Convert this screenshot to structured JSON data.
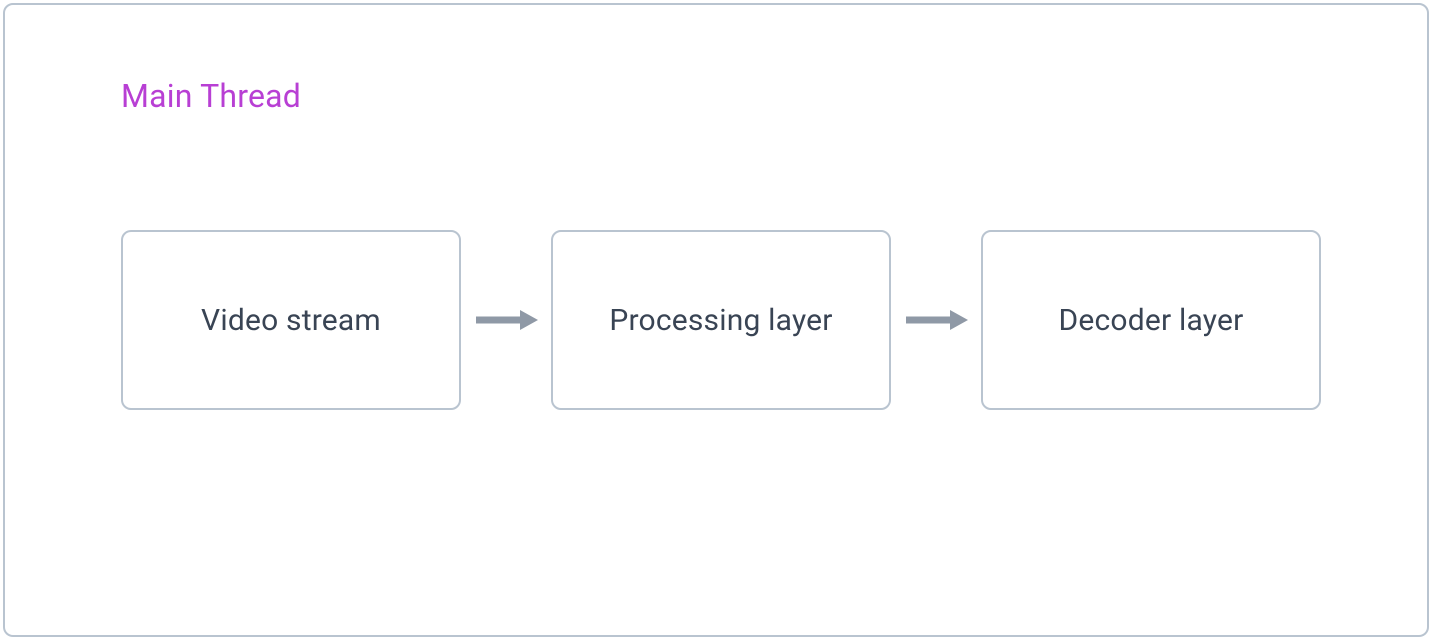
{
  "diagram": {
    "title": "Main Thread",
    "nodes": [
      {
        "label": "Video stream"
      },
      {
        "label": "Processing layer"
      },
      {
        "label": "Decoder layer"
      }
    ]
  },
  "colors": {
    "border": "#b9c4d0",
    "title": "#b83fd4",
    "node_text": "#394454",
    "arrow": "#8f99a6"
  }
}
